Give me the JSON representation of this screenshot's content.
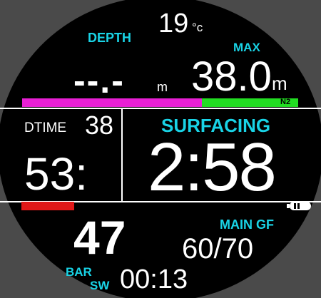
{
  "temperature": {
    "value": "19",
    "unit": "°c"
  },
  "depth": {
    "label": "DEPTH",
    "value": "--.-",
    "unit": "m"
  },
  "max_depth": {
    "label": "MAX",
    "value": "38.0",
    "unit": "m"
  },
  "gas_label": "N2",
  "gas_bar": {
    "pink_fraction": 0.55,
    "green_fraction": 0.45
  },
  "dtime": {
    "label": "DTIME",
    "value": "38",
    "big_value": "53:"
  },
  "surfacing": {
    "label": "SURFACING",
    "time": "2:58"
  },
  "status_bar": {
    "red_fraction": 0.27
  },
  "battery_icon": "battery-icon",
  "pressure": {
    "value": "47",
    "unit": "BAR"
  },
  "gradient_factor": {
    "label": "MAIN GF",
    "value": "60/70"
  },
  "stopwatch": {
    "label": "SW",
    "value": "00:13"
  },
  "colors": {
    "accent": "#19d3e6",
    "pink": "#e81fd4",
    "green": "#22dd22",
    "red": "#e01818",
    "background": "#000000",
    "bezel": "#4a4a4a"
  }
}
